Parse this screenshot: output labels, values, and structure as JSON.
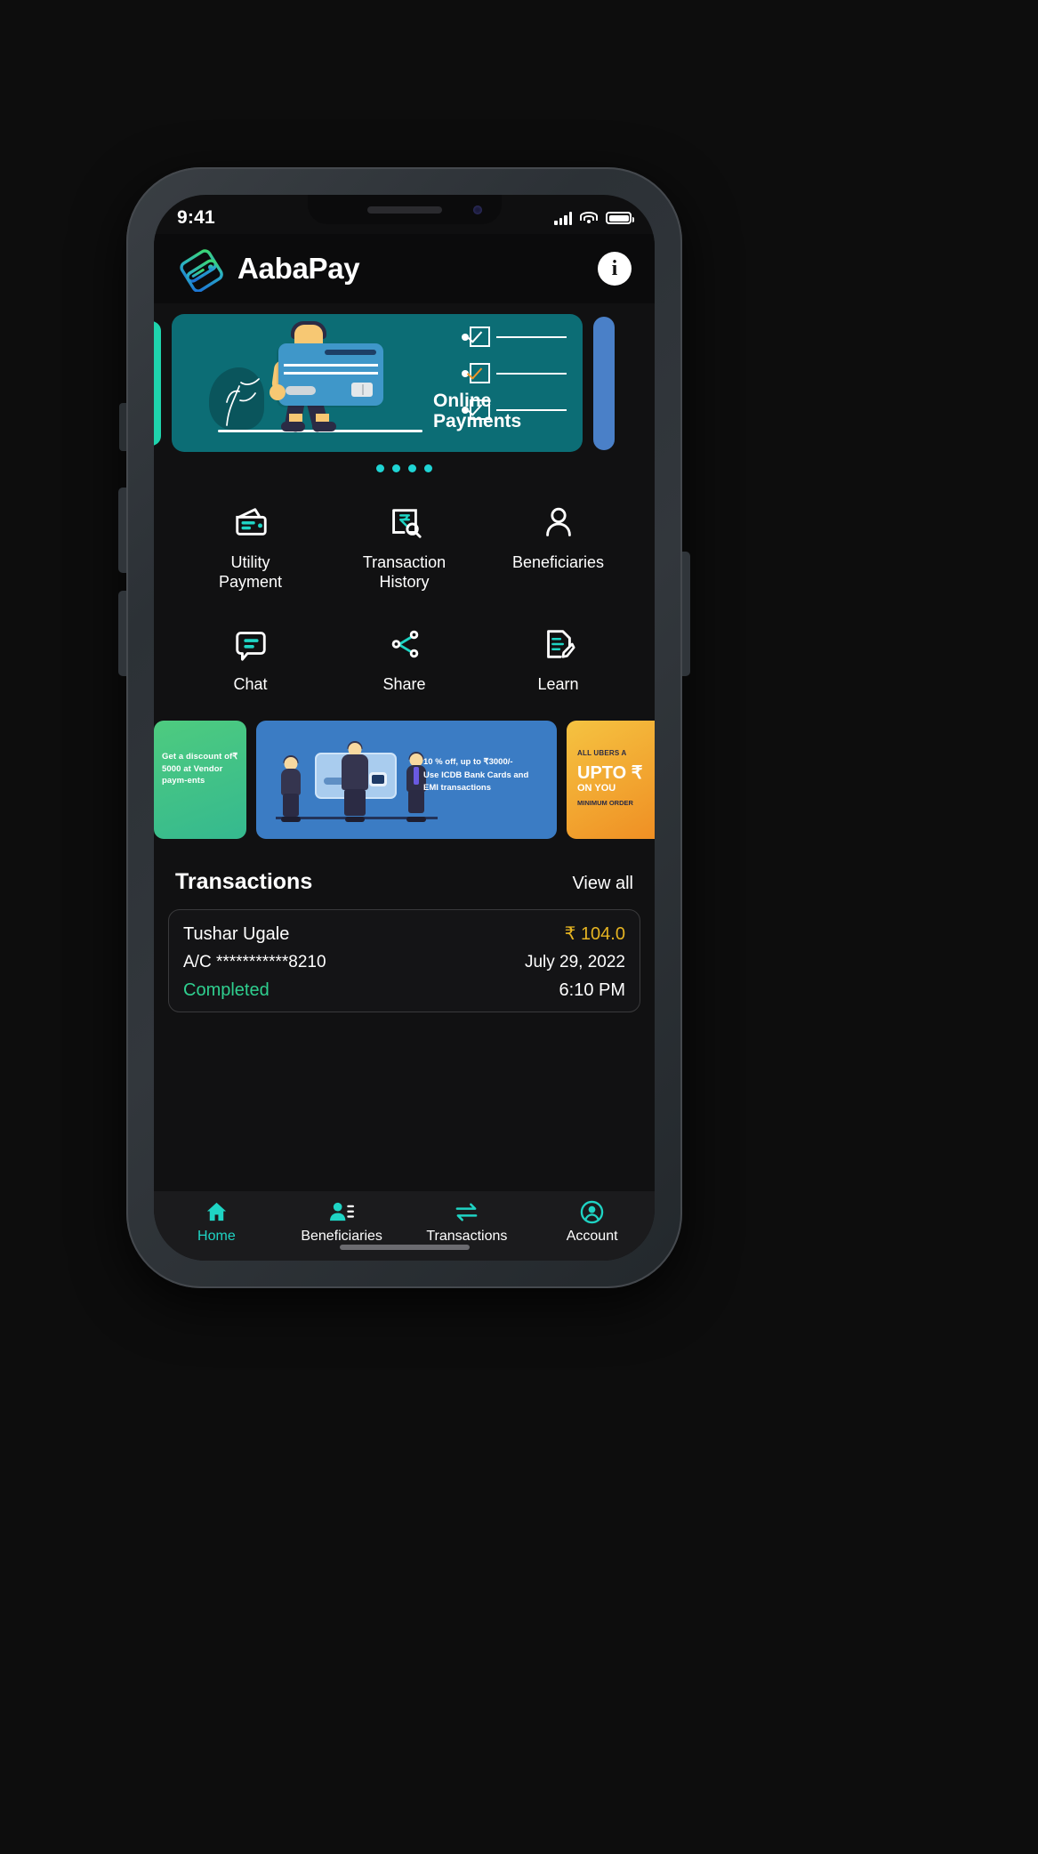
{
  "status_bar": {
    "time": "9:41",
    "signal_icon": "cellular-signal-icon",
    "wifi_icon": "wifi-icon",
    "battery_icon": "battery-icon"
  },
  "header": {
    "logo_icon": "aabapay-logo-icon",
    "title": "AabaPay",
    "info_label": "i"
  },
  "carousel": {
    "caption_line1": "Online",
    "caption_line2": "Payments",
    "dot_count": 4,
    "active_dot_index": 0,
    "bg_color": "#0c6d75",
    "peek_left_color": "#1fd4ad",
    "peek_right_color": "#4a80c8"
  },
  "quick_actions": [
    {
      "label_line1": "Utility",
      "label_line2": "Payment",
      "icon": "wallet-icon"
    },
    {
      "label_line1": "Transaction",
      "label_line2": "History",
      "icon": "rupee-search-icon"
    },
    {
      "label_line1": "Beneficiaries",
      "label_line2": "",
      "icon": "person-icon"
    },
    {
      "label_line1": "Chat",
      "label_line2": "",
      "icon": "chat-bubble-icon"
    },
    {
      "label_line1": "Share",
      "label_line2": "",
      "icon": "share-nodes-icon"
    },
    {
      "label_line1": "Learn",
      "label_line2": "",
      "icon": "document-pencil-icon"
    }
  ],
  "promos": [
    {
      "id": "vendor-discount",
      "color": "#4ecb7f",
      "text": "Get a discount of₹ 5000 at Vendor paym-ents"
    },
    {
      "id": "icdb-bank-offer",
      "color": "#3b7cc4",
      "line1": "10 % off, up to ₹3000/-",
      "line2": "Use ICDB Bank Cards and",
      "line3": "EMI transactions"
    },
    {
      "id": "uber-offer",
      "color": "#ef8c22",
      "line1": "ALL UBERS A",
      "line2": "UPTO ₹",
      "line3": "ON YOU",
      "line4": "MINIMUM ORDER"
    }
  ],
  "transactions": {
    "section_title": "Transactions",
    "view_all_label": "View all",
    "items": [
      {
        "name": "Tushar Ugale",
        "amount": "₹ 104.0",
        "account": "A/C ***********8210",
        "date": "July 29, 2022",
        "status": "Completed",
        "time": "6:10 PM"
      }
    ]
  },
  "bottom_nav": {
    "active_index": 0,
    "items": [
      {
        "label": "Home",
        "icon": "home-icon"
      },
      {
        "label": "Beneficiaries",
        "icon": "contacts-icon"
      },
      {
        "label": "Transactions",
        "icon": "transfer-arrows-icon"
      },
      {
        "label": "Account",
        "icon": "account-circle-icon"
      }
    ]
  },
  "colors": {
    "accent": "#1fd4c4",
    "amount": "#e6b422",
    "status_ok": "#2fcf8f",
    "screen_bg": "#111112"
  }
}
